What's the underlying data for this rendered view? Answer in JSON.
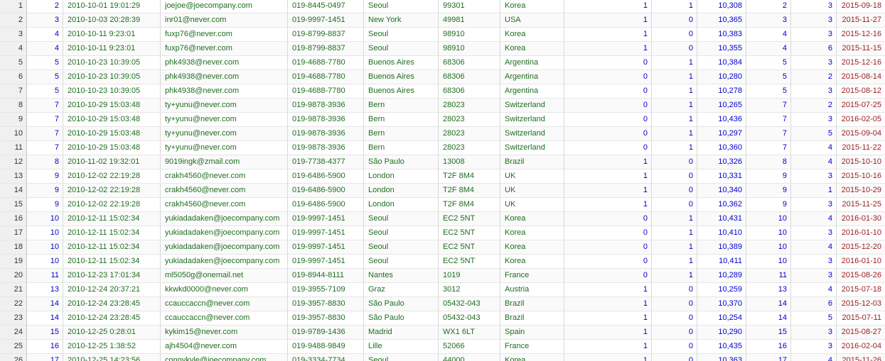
{
  "columns": [
    "row_no",
    "customer_id",
    "signup_datetime",
    "email",
    "phone",
    "city",
    "postal_code",
    "country",
    "flag_a",
    "flag_b",
    "product_code",
    "qty_a",
    "qty_b",
    "order_date"
  ],
  "colors": {
    "number": "#0000cc",
    "text": "#1f6e1f",
    "date": "#9b1c1c",
    "row_header_bg": "#f0f0f0"
  },
  "rows": [
    [
      "1",
      "2",
      "2010-10-01 19:01:29",
      "joejoe@joecompany.com",
      "019-8445-0497",
      "Seoul",
      "99301",
      "Korea",
      "1",
      "1",
      "10,308",
      "2",
      "3",
      "2015-09-18"
    ],
    [
      "2",
      "3",
      "2010-10-03 20:28:39",
      "inr01@never.com",
      "019-9997-1451",
      "New York",
      "49981",
      "USA",
      "1",
      "0",
      "10,365",
      "3",
      "3",
      "2015-11-27"
    ],
    [
      "3",
      "4",
      "2010-10-11 9:23:01",
      "fuxp76@never.com",
      "019-8799-8837",
      "Seoul",
      "98910",
      "Korea",
      "1",
      "0",
      "10,383",
      "4",
      "3",
      "2015-12-16"
    ],
    [
      "4",
      "4",
      "2010-10-11 9:23:01",
      "fuxp76@never.com",
      "019-8799-8837",
      "Seoul",
      "98910",
      "Korea",
      "1",
      "0",
      "10,355",
      "4",
      "6",
      "2015-11-15"
    ],
    [
      "5",
      "5",
      "2010-10-23 10:39:05",
      "phk4938@never.com",
      "019-4688-7780",
      "Buenos Aires",
      "68306",
      "Argentina",
      "0",
      "1",
      "10,384",
      "5",
      "3",
      "2015-12-16"
    ],
    [
      "6",
      "5",
      "2010-10-23 10:39:05",
      "phk4938@never.com",
      "019-4688-7780",
      "Buenos Aires",
      "68306",
      "Argentina",
      "0",
      "1",
      "10,280",
      "5",
      "2",
      "2015-08-14"
    ],
    [
      "7",
      "5",
      "2010-10-23 10:39:05",
      "phk4938@never.com",
      "019-4688-7780",
      "Buenos Aires",
      "68306",
      "Argentina",
      "0",
      "1",
      "10,278",
      "5",
      "3",
      "2015-08-12"
    ],
    [
      "8",
      "7",
      "2010-10-29 15:03:48",
      "ty+yunu@never.com",
      "019-9878-3936",
      "Bern",
      "28023",
      "Switzerland",
      "0",
      "1",
      "10,265",
      "7",
      "2",
      "2015-07-25"
    ],
    [
      "9",
      "7",
      "2010-10-29 15:03:48",
      "ty+yunu@never.com",
      "019-9878-3936",
      "Bern",
      "28023",
      "Switzerland",
      "0",
      "1",
      "10,436",
      "7",
      "3",
      "2016-02-05"
    ],
    [
      "10",
      "7",
      "2010-10-29 15:03:48",
      "ty+yunu@never.com",
      "019-9878-3936",
      "Bern",
      "28023",
      "Switzerland",
      "0",
      "1",
      "10,297",
      "7",
      "5",
      "2015-09-04"
    ],
    [
      "11",
      "7",
      "2010-10-29 15:03:48",
      "ty+yunu@never.com",
      "019-9878-3936",
      "Bern",
      "28023",
      "Switzerland",
      "0",
      "1",
      "10,360",
      "7",
      "4",
      "2015-11-22"
    ],
    [
      "12",
      "8",
      "2010-11-02 19:32:01",
      "9019ingk@zmail.com",
      "019-7738-4377",
      "São Paulo",
      "13008",
      "Brazil",
      "1",
      "0",
      "10,326",
      "8",
      "4",
      "2015-10-10"
    ],
    [
      "13",
      "9",
      "2010-12-02 22:19:28",
      "crakh4560@never.com",
      "019-6486-5900",
      "London",
      "T2F 8M4",
      "UK",
      "1",
      "0",
      "10,331",
      "9",
      "3",
      "2015-10-16"
    ],
    [
      "14",
      "9",
      "2010-12-02 22:19:28",
      "crakh4560@never.com",
      "019-6486-5900",
      "London",
      "T2F 8M4",
      "UK",
      "1",
      "0",
      "10,340",
      "9",
      "1",
      "2015-10-29"
    ],
    [
      "15",
      "9",
      "2010-12-02 22:19:28",
      "crakh4560@never.com",
      "019-6486-5900",
      "London",
      "T2F 8M4",
      "UK",
      "1",
      "0",
      "10,362",
      "9",
      "3",
      "2015-11-25"
    ],
    [
      "16",
      "10",
      "2010-12-11 15:02:34",
      "yukiadadaken@joecompany.com",
      "019-9997-1451",
      "Seoul",
      "EC2 5NT",
      "Korea",
      "0",
      "1",
      "10,431",
      "10",
      "4",
      "2016-01-30"
    ],
    [
      "17",
      "10",
      "2010-12-11 15:02:34",
      "yukiadadaken@joecompany.com",
      "019-9997-1451",
      "Seoul",
      "EC2 5NT",
      "Korea",
      "0",
      "1",
      "10,410",
      "10",
      "3",
      "2016-01-10"
    ],
    [
      "18",
      "10",
      "2010-12-11 15:02:34",
      "yukiadadaken@joecompany.com",
      "019-9997-1451",
      "Seoul",
      "EC2 5NT",
      "Korea",
      "0",
      "1",
      "10,389",
      "10",
      "4",
      "2015-12-20"
    ],
    [
      "19",
      "10",
      "2010-12-11 15:02:34",
      "yukiadadaken@joecompany.com",
      "019-9997-1451",
      "Seoul",
      "EC2 5NT",
      "Korea",
      "0",
      "1",
      "10,411",
      "10",
      "3",
      "2016-01-10"
    ],
    [
      "20",
      "11",
      "2010-12-23 17:01:34",
      "ml5050g@onemail.net",
      "019-8944-8111",
      "Nantes",
      "1019",
      "France",
      "0",
      "1",
      "10,289",
      "11",
      "3",
      "2015-08-26"
    ],
    [
      "21",
      "13",
      "2010-12-24 20:37:21",
      "kkwkd0000@never.com",
      "019-3955-7109",
      "Graz",
      "3012",
      "Austria",
      "1",
      "0",
      "10,259",
      "13",
      "4",
      "2015-07-18"
    ],
    [
      "22",
      "14",
      "2010-12-24 23:28:45",
      "ccauccaccn@never.com",
      "019-3957-8830",
      "São Paulo",
      "05432-043",
      "Brazil",
      "1",
      "0",
      "10,370",
      "14",
      "6",
      "2015-12-03"
    ],
    [
      "23",
      "14",
      "2010-12-24 23:28:45",
      "ccauccaccn@never.com",
      "019-3957-8830",
      "São Paulo",
      "05432-043",
      "Brazil",
      "1",
      "0",
      "10,254",
      "14",
      "5",
      "2015-07-11"
    ],
    [
      "24",
      "15",
      "2010-12-25 0:28:01",
      "kykim15@never.com",
      "019-9789-1436",
      "Madrid",
      "WX1 6LT",
      "Spain",
      "1",
      "0",
      "10,290",
      "15",
      "3",
      "2015-08-27"
    ],
    [
      "25",
      "16",
      "2010-12-25 1:38:52",
      "ajh4504@never.com",
      "019-9488-9849",
      "Lille",
      "52066",
      "France",
      "1",
      "0",
      "10,435",
      "16",
      "3",
      "2016-02-04"
    ],
    [
      "26",
      "17",
      "2010-12-25 14:23:56",
      "connykyle@joecompany.com",
      "019-3334-7734",
      "Seoul",
      "44000",
      "Korea",
      "1",
      "0",
      "10,363",
      "17",
      "4",
      "2015-11-26"
    ]
  ]
}
